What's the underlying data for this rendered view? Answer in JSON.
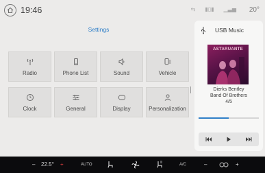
{
  "status_bar": {
    "time": "19:46",
    "temperature": "20°"
  },
  "settings": {
    "title": "Settings",
    "tiles": [
      {
        "label": "Radio",
        "icon": "radio-antenna-icon"
      },
      {
        "label": "Phone List",
        "icon": "phone-icon"
      },
      {
        "label": "Sound",
        "icon": "speaker-icon"
      },
      {
        "label": "Vehicle",
        "icon": "vehicle-icon"
      },
      {
        "label": "Clock",
        "icon": "clock-icon"
      },
      {
        "label": "General",
        "icon": "sliders-icon"
      },
      {
        "label": "Display",
        "icon": "display-icon"
      },
      {
        "label": "Personalization",
        "icon": "person-icon"
      }
    ]
  },
  "media": {
    "source": "USB Music",
    "album_text": "ASTARUANTE",
    "track_title": "Dierks Bentley",
    "artist": "Band Of Brothers",
    "track_number": "4/5",
    "progress_fraction": 0.5,
    "accent_color": "#2f7fc8"
  },
  "climate": {
    "driver_temp": "22.5°",
    "auto_label": "AUTO",
    "ac_label": "A/C"
  }
}
